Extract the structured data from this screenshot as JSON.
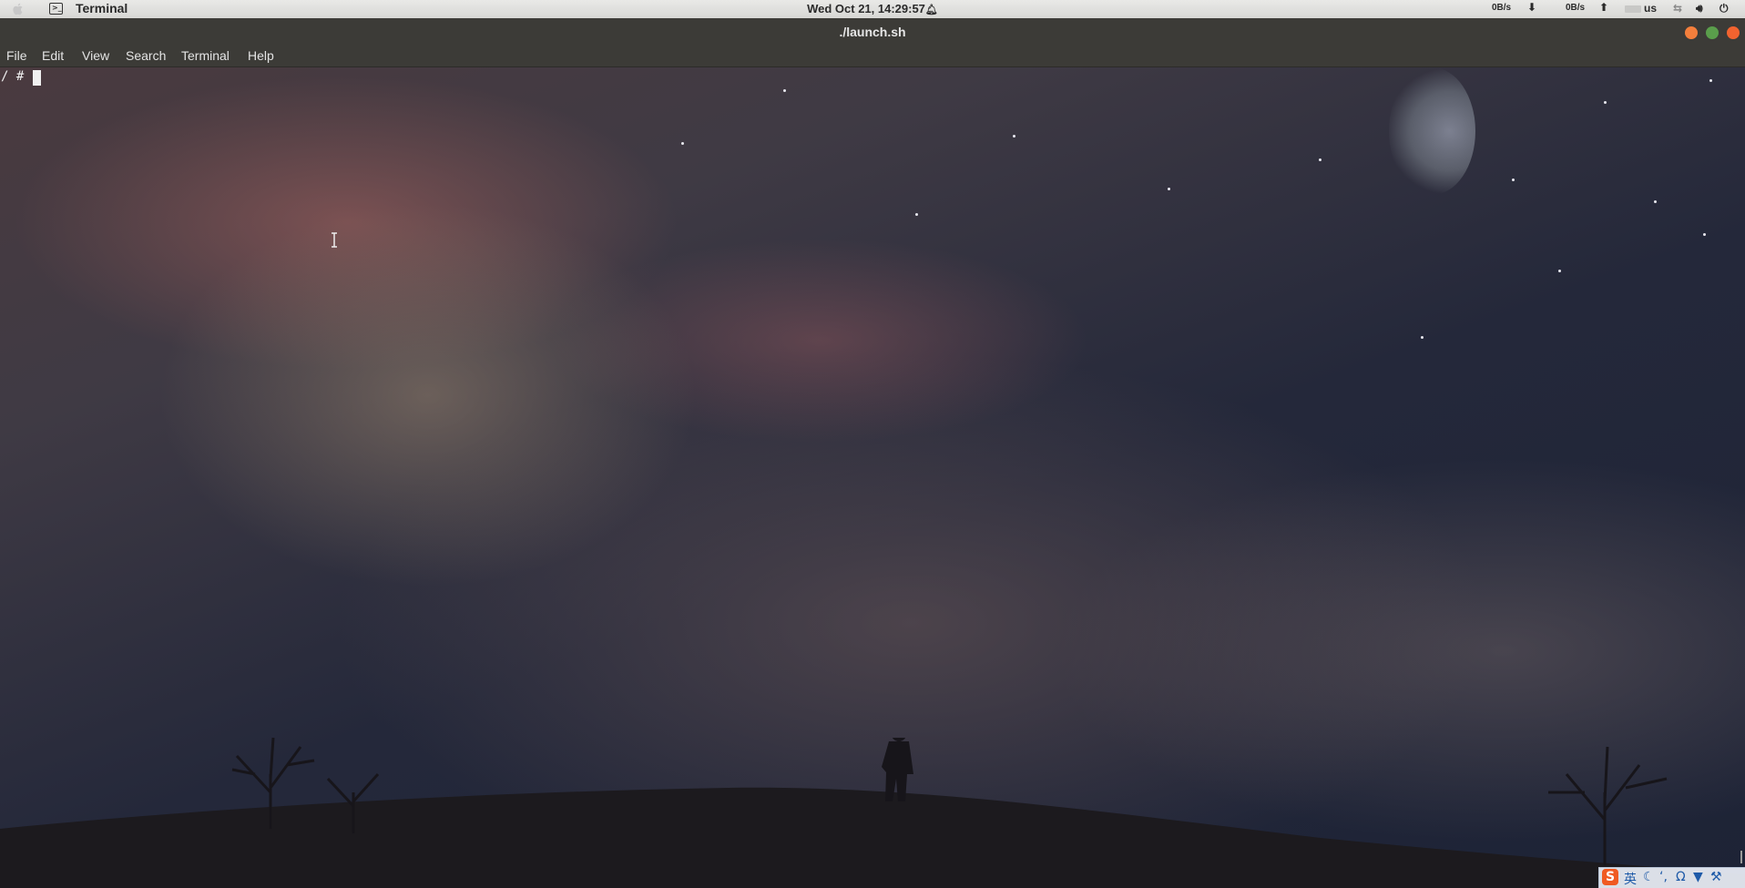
{
  "top_panel": {
    "app_name": "Terminal",
    "clock": "Wed Oct 21, 14:29:57",
    "net_down": "0B/s",
    "net_up": "0B/s",
    "keyboard_layout": "us",
    "icons": [
      "apple-icon",
      "terminal-app-icon",
      "bell-icon",
      "download-arrow-icon",
      "upload-arrow-icon",
      "network-icon",
      "volume-icon",
      "power-icon"
    ]
  },
  "window": {
    "title": "./launch.sh",
    "buttons": [
      "minimize",
      "maximize",
      "close"
    ],
    "colors": {
      "minimize": "#f47f3c",
      "maximize": "#5a9e4b",
      "close": "#f2632f"
    }
  },
  "menu": {
    "items": [
      "File",
      "Edit",
      "View",
      "Search",
      "Terminal",
      "Help"
    ]
  },
  "terminal": {
    "prompt": "/ #"
  },
  "ime": {
    "logo": "S",
    "mode": "英",
    "icons": [
      "moon-icon",
      "punctuation-icon",
      "omega-icon",
      "shirt-icon",
      "wrench-icon"
    ]
  }
}
